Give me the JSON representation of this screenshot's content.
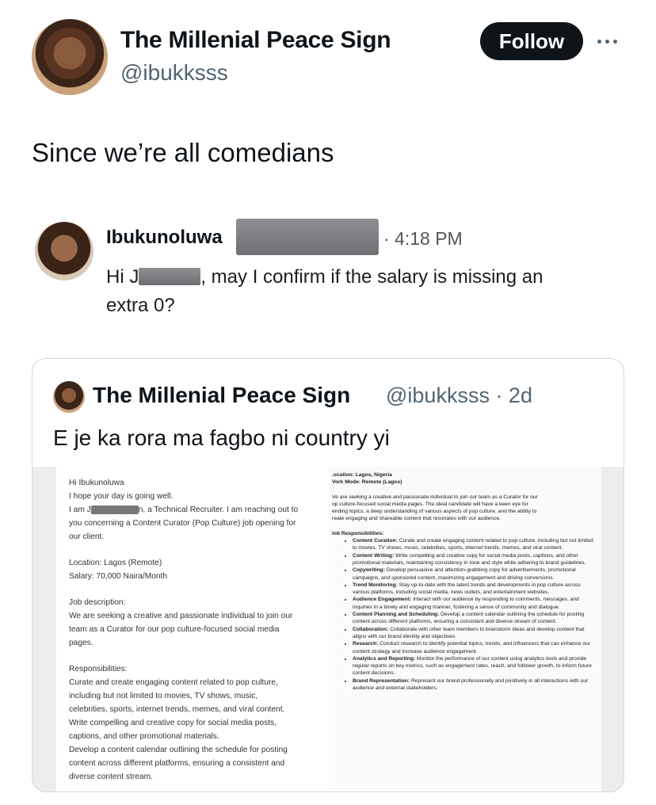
{
  "author": {
    "name": "The Millenial Peace Sign",
    "handle": "@ibukksss"
  },
  "follow_label": "Follow",
  "more_icon": "more-horizontal-icon",
  "tweet": {
    "text": "Since we’re all comedians"
  },
  "dm": {
    "sender": "Ibukunoluwa",
    "time": "· 4:18 PM",
    "line1_a": "Hi J",
    "line1_b": ", may I confirm if the salary is missing an",
    "line2": "extra 0?"
  },
  "quote": {
    "name": "The Millenial Peace Sign",
    "meta": "@ibukksss · 2d",
    "text": "E je ka rora ma fagbo ni country yi",
    "left": {
      "greeting": "Hi Ibukunoluwa",
      "hope": "I hope your day is going well.",
      "intro_a": "I am J",
      "intro_b": "n, a Technical Recruiter. I am reaching out to",
      "intro_c": "you concerning a Content Curator (Pop Culture) job opening for",
      "intro_d": "our client.",
      "location": "Location: Lagos (Remote)",
      "salary": "Salary: 70,000 Naira/Month",
      "jd_head": "Job description:",
      "jd_1": "We are seeking a creative and passionate individual to join our",
      "jd_2": "team as a Curator for our pop culture-focused social media",
      "jd_3": "pages.",
      "resp_head": "Responsibilities:",
      "resp_lines": [
        "Curate and create engaging content related to pop culture,",
        "including but not limited to movies, TV shows, music,",
        "celebrities, sports, internet trends, memes, and viral content.",
        "Write compelling and creative copy for social media posts,",
        "captions, and other promotional materials.",
        "Develop a content calendar outlining the schedule for posting",
        "content across different platforms, ensuring a consistent and",
        "diverse content stream."
      ]
    },
    "right": {
      "location": ".ocation: Lagos, Nigeria",
      "workmode": "Vork Mode: Remote (Lagos)",
      "intro_lines": [
        "Ve are seeking a creative and passionate individual to join our team as a Curator for our",
        "op culture-focused social media pages. The ideal candidate will have a keen eye for",
        "ending topics, a deep understanding of various aspects of pop culture, and the ability to",
        "reate engaging and shareable content that resonates with our audience."
      ],
      "resp_head": "lob Responsibilities:",
      "items": [
        {
          "title": "Content Curation:",
          "text": "Curate and create engaging content related to pop culture, including but not limited to movies, TV shows, music, celebrities, sports, internet trends, memes, and viral content."
        },
        {
          "title": "Content Writing:",
          "text": "Write compelling and creative copy for social media posts, captions, and other promotional materials, maintaining consistency in tone and style while adhering to brand guidelines."
        },
        {
          "title": "Copywriting:",
          "text": "Develop persuasive and attention-grabbing copy for advertisements, promotional campaigns, and sponsored content, maximizing engagement and driving conversions."
        },
        {
          "title": "Trend Monitoring:",
          "text": "Stay up-to-date with the latest trends and developments in pop culture across various platforms, including social media, news outlets, and entertainment websites."
        },
        {
          "title": "Audience Engagement:",
          "text": "Interact with our audience by responding to comments, messages, and inquiries in a timely and engaging manner, fostering a sense of community and dialogue."
        },
        {
          "title": "Content Planning and Scheduling:",
          "text": "Develop a content calendar outlining the schedule for posting content across different platforms, ensuring a consistent and diverse stream of content."
        },
        {
          "title": "Collaboration:",
          "text": "Collaborate with other team members to brainstorm ideas and develop content that aligns with our brand identity and objectives."
        },
        {
          "title": "Research:",
          "text": "Conduct research to identify potential topics, trends, and influencers that can enhance our content strategy and increase audience engagement."
        },
        {
          "title": "Analytics and Reporting:",
          "text": "Monitor the performance of our content using analytics tools and provide regular reports on key metrics, such as engagement rates, reach, and follower growth, to inform future content decisions."
        },
        {
          "title": "Brand Representation:",
          "text": "Represent our brand professionally and positively in all interactions with our audience and external stakeholders."
        }
      ]
    }
  }
}
